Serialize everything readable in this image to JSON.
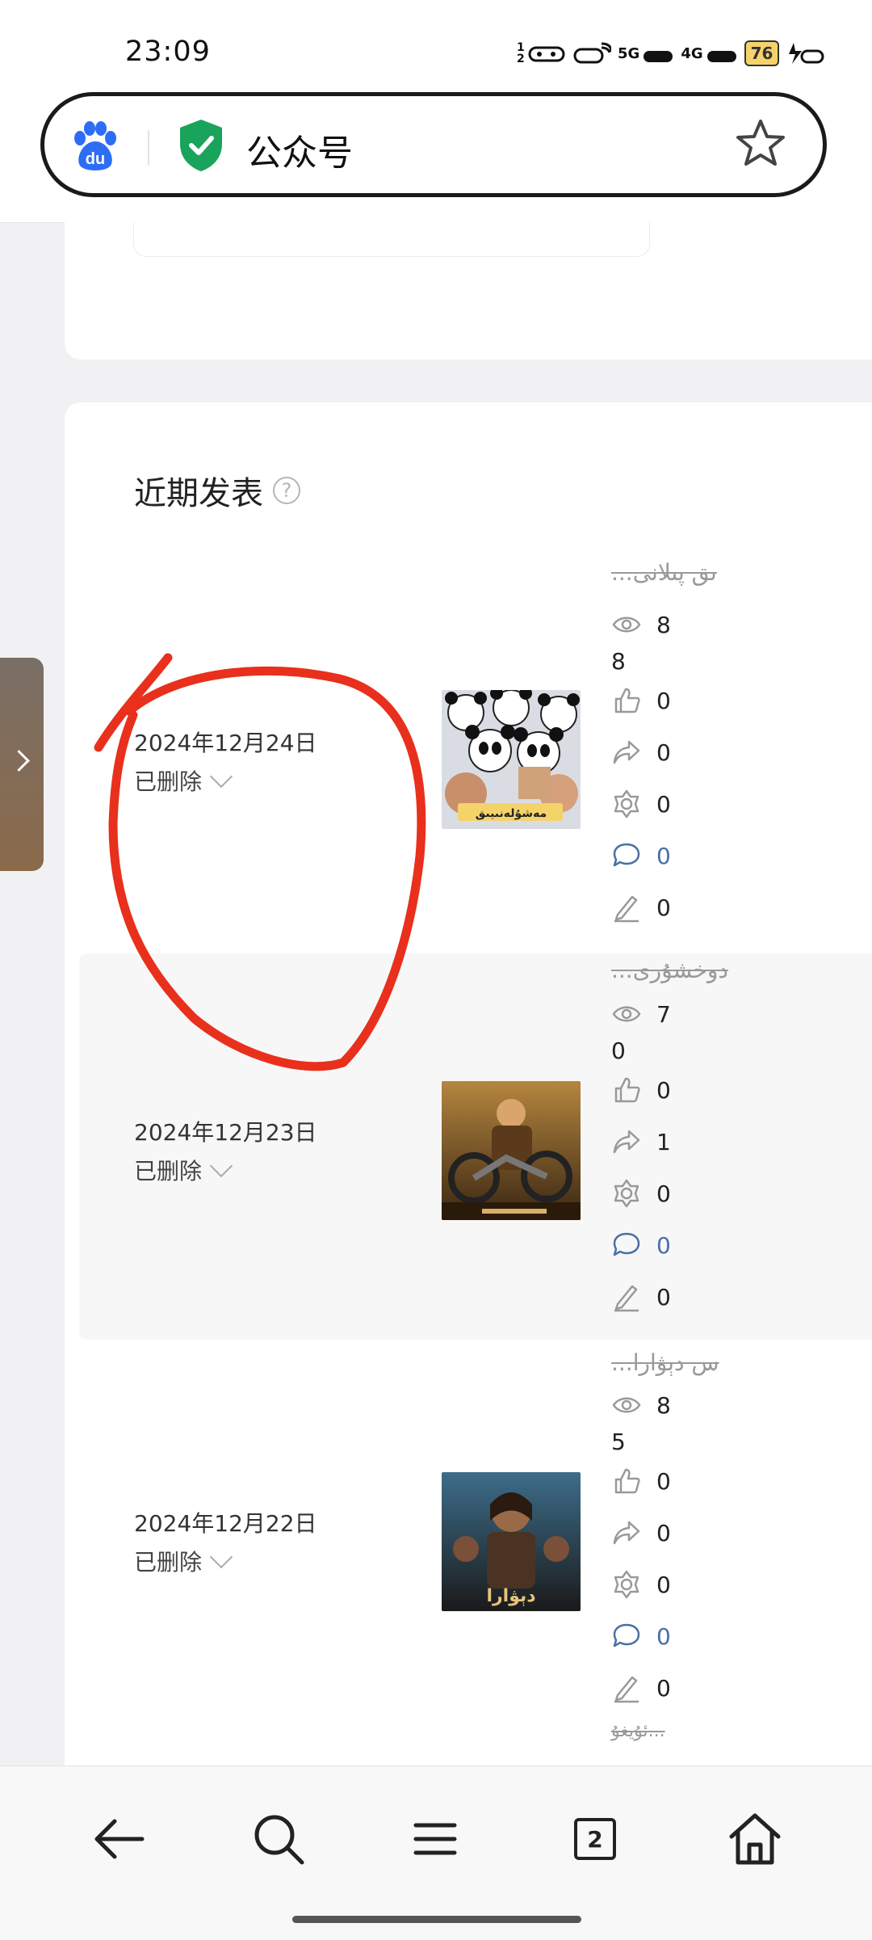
{
  "status_bar": {
    "time": "23:09",
    "icons": [
      "sim-1-2-icon",
      "wifi-icon",
      "signal-5g-icon",
      "signal-4g-icon",
      "battery-icon",
      "charging-icon"
    ],
    "network_5g": "5G",
    "network_4g": "4G",
    "sim_label": "1 2",
    "battery_level": "76"
  },
  "address_bar": {
    "text": "公众号",
    "logo": "baidu-logo",
    "logo_text": "du",
    "secure_icon": "shield-check-icon",
    "bookmark_icon": "star-icon"
  },
  "section": {
    "title": "近期发表",
    "help": "?"
  },
  "posts": [
    {
      "date": "2024年12月24日",
      "status": "已删除",
      "title": "...ىق پىلانى",
      "thumb_caption": "مەشۇلەنىيىق",
      "views_a": "8",
      "views_b": "8",
      "likes": "0",
      "shares": "0",
      "favorites": "0",
      "comments": "0",
      "edits": "0"
    },
    {
      "date": "2024年12月23日",
      "status": "已删除",
      "title": "...دوخشۇرى",
      "thumb_caption": "",
      "views_a": "7",
      "views_b": "0",
      "likes": "0",
      "shares": "1",
      "favorites": "0",
      "comments": "0",
      "edits": "0"
    },
    {
      "date": "2024年12月22日",
      "status": "已删除",
      "title": "...س دېۋارا",
      "thumb_caption": "دېۋارا",
      "views_a": "8",
      "views_b": "5",
      "likes": "0",
      "shares": "0",
      "favorites": "0",
      "comments": "0",
      "edits": "0"
    }
  ],
  "partial_next_title": "ئۇيغۇ...",
  "side_handle": {
    "icon": "chevron-right-icon"
  },
  "bottom_nav": {
    "items": [
      "back-arrow-icon",
      "search-icon",
      "menu-icon",
      "tabs-icon",
      "home-icon"
    ],
    "tab_count": "2"
  },
  "colors": {
    "annotation_red": "#e8301c",
    "comment_blue": "#4a6fa5",
    "shield_green": "#1aa35a",
    "baidu_blue": "#2d6df6"
  }
}
